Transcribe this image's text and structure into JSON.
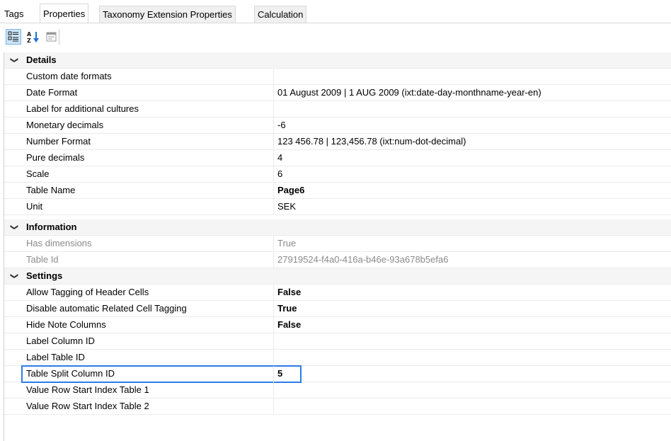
{
  "tabs": [
    {
      "label": "Tags"
    },
    {
      "label": "Properties"
    },
    {
      "label": "Taxonomy Extension Properties"
    },
    {
      "label": "Calculation"
    }
  ],
  "toolbar": {
    "categorized_icon": "categorized-view-icon",
    "alphabetical_icon": "sort-alphabetical-icon",
    "property_pages_icon": "property-pages-icon"
  },
  "categories": [
    {
      "label": "Details",
      "rows": [
        {
          "name": "Custom date formats",
          "value": ""
        },
        {
          "name": "Date Format",
          "value": "01 August 2009 | 1 AUG 2009 (ixt:date-day-monthname-year-en)"
        },
        {
          "name": "Label for additional cultures",
          "value": ""
        },
        {
          "name": "Monetary decimals",
          "value": "-6"
        },
        {
          "name": "Number Format",
          "value": "123 456.78 | 123,456.78 (ixt:num-dot-decimal)"
        },
        {
          "name": "Pure decimals",
          "value": "4"
        },
        {
          "name": "Scale",
          "value": "6"
        },
        {
          "name": "Table Name",
          "value": "Page6",
          "bold": true
        },
        {
          "name": "Unit",
          "value": "SEK"
        }
      ]
    },
    {
      "label": "Information",
      "rows": [
        {
          "name": "Has dimensions",
          "value": "True",
          "readonly": true
        },
        {
          "name": "Table Id",
          "value": "27919524-f4a0-416a-b46e-93a678b5efa6",
          "readonly": true
        }
      ]
    },
    {
      "label": "Settings",
      "rows": [
        {
          "name": "Allow Tagging of Header Cells",
          "value": "False",
          "bold": true
        },
        {
          "name": "Disable automatic Related Cell Tagging",
          "value": "True",
          "bold": true
        },
        {
          "name": "Hide Note Columns",
          "value": "False",
          "bold": true
        },
        {
          "name": "Label Column ID",
          "value": ""
        },
        {
          "name": "Label Table ID",
          "value": ""
        },
        {
          "name": "Table Split Column ID",
          "value": "5",
          "bold": true,
          "focused": true
        },
        {
          "name": "Value Row Start Index Table 1",
          "value": ""
        },
        {
          "name": "Value Row Start Index Table 2",
          "value": ""
        }
      ]
    }
  ],
  "colors": {
    "focus": "#2b7de9",
    "category_bg": "#f5f5f5",
    "readonly_text": "#8a8a8a"
  }
}
